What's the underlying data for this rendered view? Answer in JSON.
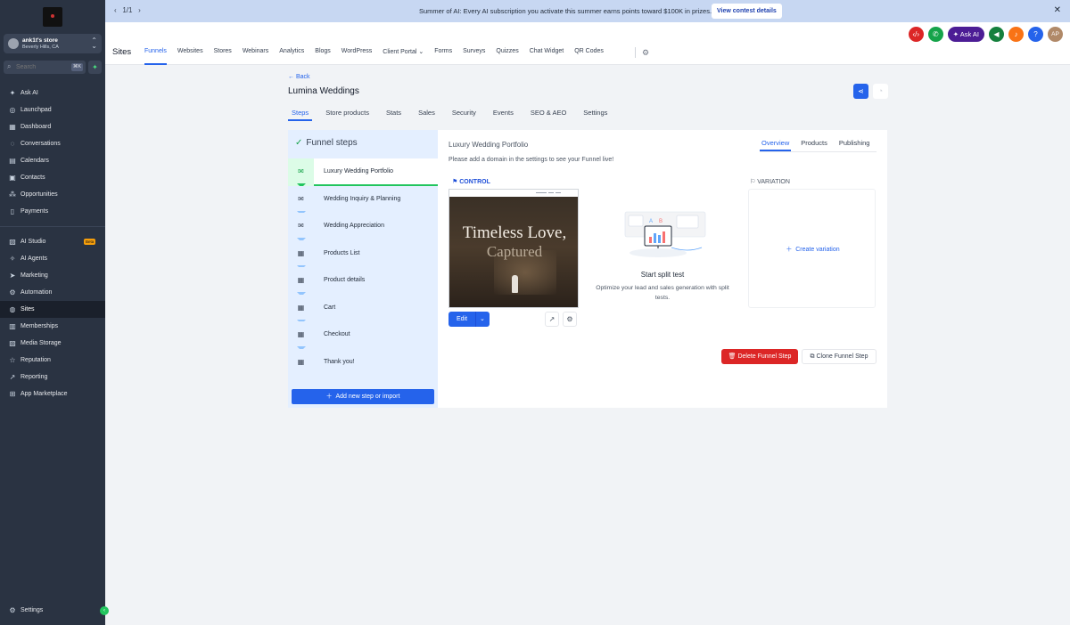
{
  "sidebar": {
    "account": {
      "name": "ank1t's store",
      "location": "Beverly Hills, CA"
    },
    "search": {
      "placeholder": "Search",
      "shortcut": "⌘K"
    },
    "items_top": [
      {
        "label": "Ask AI",
        "icon": "sparkle-icon"
      },
      {
        "label": "Launchpad",
        "icon": "rocket-icon"
      },
      {
        "label": "Dashboard",
        "icon": "grid-icon"
      },
      {
        "label": "Conversations",
        "icon": "chat-icon"
      },
      {
        "label": "Calendars",
        "icon": "calendar-icon"
      },
      {
        "label": "Contacts",
        "icon": "contacts-icon"
      },
      {
        "label": "Opportunities",
        "icon": "opportunities-icon"
      },
      {
        "label": "Payments",
        "icon": "payments-icon"
      }
    ],
    "items_bottom": [
      {
        "label": "AI Studio",
        "icon": "ai-studio-icon",
        "badge": "Beta"
      },
      {
        "label": "AI Agents",
        "icon": "ai-agents-icon"
      },
      {
        "label": "Marketing",
        "icon": "send-icon"
      },
      {
        "label": "Automation",
        "icon": "automation-icon"
      },
      {
        "label": "Sites",
        "icon": "globe-icon",
        "active": true
      },
      {
        "label": "Memberships",
        "icon": "memberships-icon"
      },
      {
        "label": "Media Storage",
        "icon": "media-icon"
      },
      {
        "label": "Reputation",
        "icon": "star-icon"
      },
      {
        "label": "Reporting",
        "icon": "chart-icon"
      },
      {
        "label": "App Marketplace",
        "icon": "apps-icon"
      }
    ],
    "settings_label": "Settings"
  },
  "banner": {
    "pager": "1/1",
    "text": "Summer of AI: Every AI subscription you activate this summer earns points toward $100K in prizes.",
    "button": "View contest details"
  },
  "header": {
    "title": "Sites",
    "tabs": [
      "Funnels",
      "Websites",
      "Stores",
      "Webinars",
      "Analytics",
      "Blogs",
      "WordPress",
      "Client Portal",
      "Forms",
      "Surveys",
      "Quizzes",
      "Chat Widget",
      "QR Codes"
    ],
    "ask_ai": "Ask AI",
    "avatar": "AP"
  },
  "funnel": {
    "back": "Back",
    "title": "Lumina Weddings",
    "tabs": [
      "Steps",
      "Store products",
      "Stats",
      "Sales",
      "Security",
      "Events",
      "SEO & AEO",
      "Settings"
    ],
    "steps_title": "Funnel steps",
    "steps": [
      {
        "label": "Luxury Wedding Portfolio",
        "icon": "mail-icon",
        "active": true
      },
      {
        "label": "Wedding Inquiry & Planning",
        "icon": "mail-icon"
      },
      {
        "label": "Wedding Appreciation",
        "icon": "mail-icon"
      },
      {
        "label": "Products List",
        "icon": "store-icon"
      },
      {
        "label": "Product details",
        "icon": "store-icon"
      },
      {
        "label": "Cart",
        "icon": "store-icon"
      },
      {
        "label": "Checkout",
        "icon": "store-icon"
      },
      {
        "label": "Thank you!",
        "icon": "store-icon"
      }
    ],
    "add_step": "Add new step or import"
  },
  "step_detail": {
    "title": "Luxury Wedding Portfolio",
    "tabs": [
      "Overview",
      "Products",
      "Publishing"
    ],
    "note": "Please add a domain in the settings to see your Funnel live!",
    "control_label": "CONTROL",
    "variation_label": "VARIATION",
    "preview_line1": "Timeless Love,",
    "preview_line2": "Captured",
    "edit": "Edit",
    "split_title": "Start split test",
    "split_desc": "Optimize your lead and sales generation with split tests.",
    "create_variation": "Create variation",
    "delete": "Delete Funnel Step",
    "clone": "Clone Funnel Step"
  }
}
